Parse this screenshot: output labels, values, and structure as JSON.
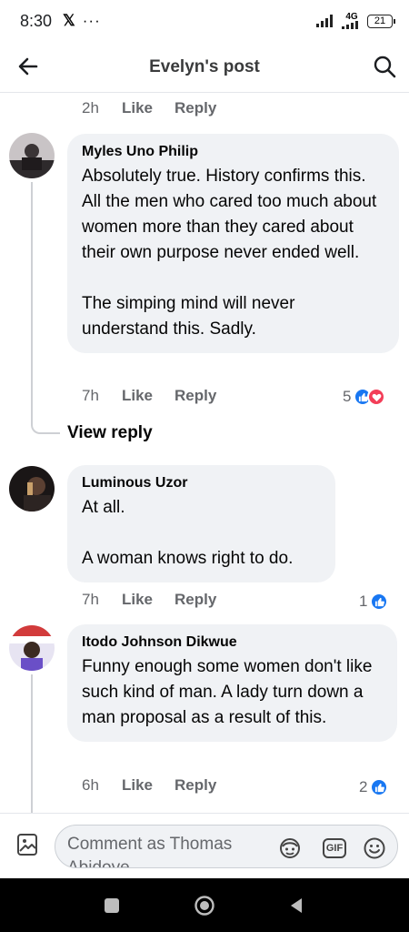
{
  "status_bar": {
    "time": "8:30",
    "x_logo": "𝕏",
    "dots": "···",
    "network": "4G",
    "battery": "21"
  },
  "header": {
    "title": "Evelyn's post",
    "back_icon": "arrow-left-icon",
    "search_icon": "search-icon"
  },
  "comments": [
    {
      "time": "2h",
      "like_label": "Like",
      "reply_label": "Reply"
    },
    {
      "author": "Myles Uno Philip",
      "text": "Absolutely true. History confirms this. All the men who cared too much about women more than they cared about their own purpose never ended well.\n\nThe simping mind will never understand this. Sadly.",
      "time": "7h",
      "like_label": "Like",
      "reply_label": "Reply",
      "reaction_count": "5",
      "reactions": [
        "like",
        "love"
      ],
      "view_reply_label": "View reply"
    },
    {
      "author": "Luminous Uzor",
      "text": "At all.\n\nA woman knows right to do.",
      "time": "7h",
      "like_label": "Like",
      "reply_label": "Reply",
      "reaction_count": "1",
      "reactions": [
        "like"
      ]
    },
    {
      "author": "Itodo Johnson Dikwue",
      "text": "Funny enough some women don't like such kind of man. A lady turn down a man proposal as a result of this.",
      "time": "6h",
      "like_label": "Like",
      "reply_label": "Reply",
      "reaction_count": "2",
      "reactions": [
        "like"
      ]
    }
  ],
  "composer": {
    "placeholder": "Comment as Thomas Abidoye",
    "gif_label": "GIF",
    "icons": [
      "photo-icon",
      "avatar-sticker-icon",
      "gif-icon",
      "emoji-icon"
    ]
  },
  "colors": {
    "bubble": "#f0f2f5",
    "muted_text": "#65676b",
    "like_blue": "#1877f2",
    "love_red": "#f33e58"
  }
}
